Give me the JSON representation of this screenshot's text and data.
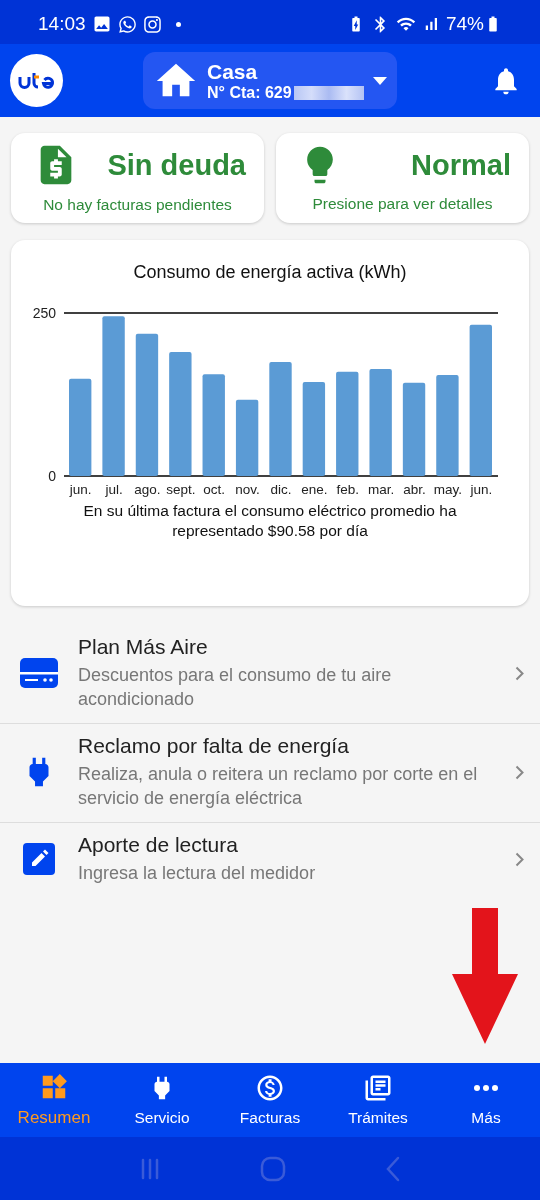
{
  "status_bar": {
    "time": "14:03",
    "battery": "74%"
  },
  "header": {
    "account_name": "Casa",
    "account_number": "N° Cta: 629"
  },
  "summary_cards": [
    {
      "title": "Sin deuda",
      "subtitle": "No hay facturas pendientes"
    },
    {
      "title": "Normal",
      "subtitle": "Presione para ver detalles"
    }
  ],
  "consumption": {
    "chart_data": {
      "type": "bar",
      "title": "Consumo de energía activa (kWh)",
      "categories": [
        "jun.",
        "jul.",
        "ago.",
        "sept.",
        "oct.",
        "nov.",
        "dic.",
        "ene.",
        "feb.",
        "mar.",
        "abr.",
        "may.",
        "jun."
      ],
      "values": [
        149,
        245,
        218,
        190,
        156,
        117,
        175,
        144,
        160,
        164,
        143,
        155,
        232
      ],
      "ylim": [
        0,
        250
      ],
      "yticks": [
        0,
        250
      ]
    },
    "note": "En su última factura el consumo eléctrico promedio ha representado $90.58 por día"
  },
  "menu_items": [
    {
      "title": "Plan Más Aire",
      "description": "Descuentos para el consumo de tu aire acondicionado"
    },
    {
      "title": "Reclamo por falta de energía",
      "description": "Realiza, anula o reitera un reclamo por corte en el servicio de energía eléctrica"
    },
    {
      "title": "Aporte de lectura",
      "description": "Ingresa la lectura del medidor"
    }
  ],
  "bottom_nav": [
    {
      "label": "Resumen",
      "selected": true
    },
    {
      "label": "Servicio",
      "selected": false
    },
    {
      "label": "Facturas",
      "selected": false
    },
    {
      "label": "Trámites",
      "selected": false
    },
    {
      "label": "Más",
      "selected": false
    }
  ]
}
